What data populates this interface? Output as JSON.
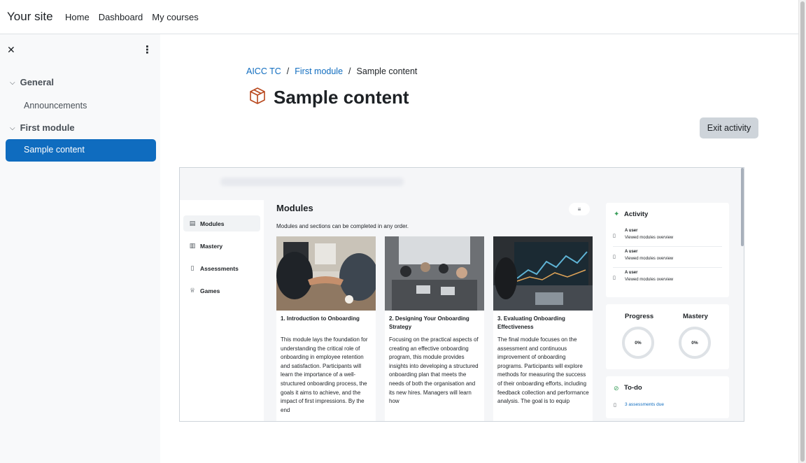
{
  "header": {
    "site_name": "Your site",
    "nav": [
      {
        "label": "Home"
      },
      {
        "label": "Dashboard"
      },
      {
        "label": "My courses"
      }
    ]
  },
  "drawer": {
    "close_icon": "close-icon",
    "menu_icon": "kebab-menu-icon",
    "sections": [
      {
        "label": "General",
        "items": [
          "Announcements"
        ]
      },
      {
        "label": "First module",
        "items": [
          "Sample content"
        ]
      }
    ],
    "active_item": "Sample content"
  },
  "breadcrumb": {
    "items": [
      "AICC TC",
      "First module",
      "Sample content"
    ]
  },
  "page": {
    "title": "Sample content",
    "icon": "package-box-icon",
    "exit_button": "Exit activity"
  },
  "embedded": {
    "sidebar": [
      "Modules",
      "Mastery",
      "Assessments",
      "Games"
    ],
    "modules_title": "Modules",
    "modules_subtitle": "Modules and sections can be completed in any order.",
    "cards": [
      {
        "title": "1. Introduction to Onboarding",
        "body": "This module lays the foundation for understanding the critical role of onboarding in employee retention and satisfaction. Participants will learn the importance of a well-structured onboarding process, the goals it aims to achieve, and the impact of first impressions. By the end"
      },
      {
        "title": "2. Designing Your Onboarding Strategy",
        "body": "Focusing on the practical aspects of creating an effective onboarding program, this module provides insights into developing a structured onboarding plan that meets the needs of both the organisation and its new hires. Managers will learn how"
      },
      {
        "title": "3. Evaluating Onboarding Effectiveness",
        "body": "The final module focuses on the assessment and continuous improvement of onboarding programs. Participants will explore methods for measuring the success of their onboarding efforts, including feedback collection and performance analysis. The goal is to equip"
      }
    ],
    "activity": {
      "title": "Activity",
      "entries": [
        {
          "user": "A user",
          "text": "Viewed modules overview"
        },
        {
          "user": "A user",
          "text": "Viewed modules overview"
        },
        {
          "user": "A user",
          "text": "Viewed modules overview"
        }
      ]
    },
    "progress": {
      "label": "Progress",
      "value": "0%"
    },
    "mastery": {
      "label": "Mastery",
      "value": "0%"
    },
    "todo": {
      "title": "To-do",
      "item": "3 assessments due"
    }
  },
  "colors": {
    "accent": "#0f6cbf",
    "drawer_bg": "#f8f9fa",
    "button_bg": "#ced4da",
    "success": "#3a9e5b"
  }
}
